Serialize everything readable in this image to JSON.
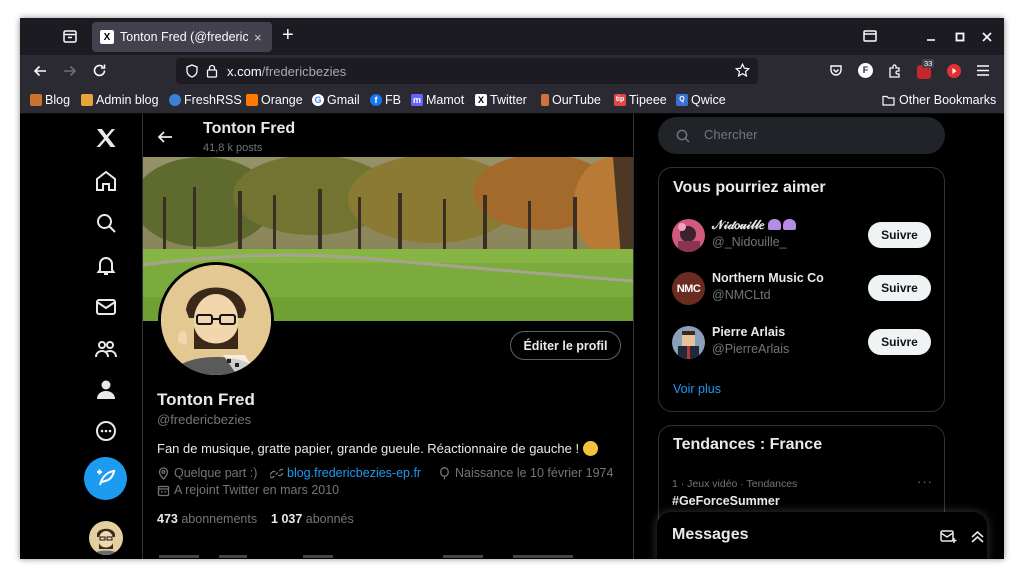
{
  "browser": {
    "tab_title": "Tonton Fred (@fredericbezies)",
    "tab_close": "×",
    "new_tab": "+",
    "url_domain": "x.com",
    "url_path": "/fredericbezies",
    "extension_badge": "33",
    "bookmarks": [
      {
        "label": "Blog",
        "color": "#c9742c"
      },
      {
        "label": "Admin blog",
        "color": "#e8a33b"
      },
      {
        "label": "FreshRSS",
        "color": "#3b82d6"
      },
      {
        "label": "Orange",
        "color": "#ff7900"
      },
      {
        "label": "Gmail",
        "color": "#ffffff"
      },
      {
        "label": "FB",
        "color": "#1877f2"
      },
      {
        "label": "Mamot",
        "color": "#6364ff"
      },
      {
        "label": "Twitter",
        "color": "#ffffff"
      },
      {
        "label": "OurTube",
        "color": "#d0733b"
      },
      {
        "label": "Tipeee",
        "color": "#e04848"
      },
      {
        "label": "Qwice",
        "color": "#3b6fd6"
      }
    ],
    "other_bookmarks": "Other Bookmarks"
  },
  "profile": {
    "header_name": "Tonton Fred",
    "post_count": "41,8 k posts",
    "edit_profile": "Éditer le profil",
    "name": "Tonton Fred",
    "handle": "@fredericbezies",
    "bio": "Fan de musique, gratte papier, grande gueule. Réactionnaire de gauche !",
    "location": "Quelque part :)",
    "website": "blog.fredericbezies-ep.fr",
    "birth": "Naissance le 10 février 1974",
    "joined": "A rejoint Twitter en mars 2010",
    "following_count": "473",
    "following_label": "abonnements",
    "followers_count": "1 037",
    "followers_label": "abonnés"
  },
  "search": {
    "placeholder": "Chercher"
  },
  "suggestions": {
    "title": "Vous pourriez aimer",
    "follow_label": "Suivre",
    "more": "Voir plus",
    "items": [
      {
        "name": "𝒩𝒾𝒹𝑜𝓊𝒾𝓁𝓁𝑒",
        "handle": "@_Nidouille_"
      },
      {
        "name": "Northern Music Co",
        "handle": "@NMCLtd",
        "avatar_text": "NMC"
      },
      {
        "name": "Pierre Arlais",
        "handle": "@PierreArlais"
      }
    ]
  },
  "trends": {
    "title": "Tendances : France",
    "item_meta": "1 · Jeux vidéo · Tendances",
    "item_name": "#GeForceSummer",
    "more": "···"
  },
  "messages": {
    "title": "Messages"
  },
  "colors": {
    "accent": "#1d9bf0",
    "background": "#000000",
    "border": "#2f3336",
    "muted": "#71767b"
  }
}
